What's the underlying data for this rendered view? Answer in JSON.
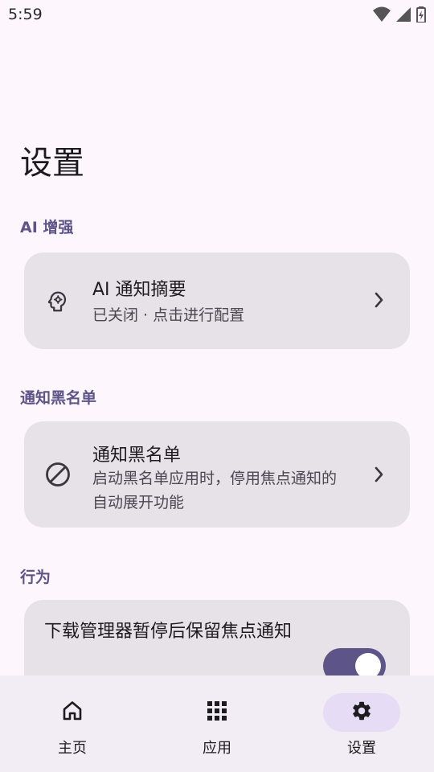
{
  "status_bar": {
    "time": "5:59"
  },
  "page": {
    "title": "设置"
  },
  "sections": {
    "ai": {
      "header": "AI 增强",
      "card": {
        "title": "AI 通知摘要",
        "subtitle": "已关闭 · 点击进行配置",
        "icon": "psychology-icon"
      }
    },
    "blacklist": {
      "header": "通知黑名单",
      "card": {
        "title": "通知黑名单",
        "subtitle": "启动黑名单应用时，停用焦点通知的自动展开功能",
        "icon": "block-icon"
      }
    },
    "behavior": {
      "header": "行为",
      "toggle": {
        "label": "下载管理器暂停后保留焦点通知",
        "checked": true
      }
    }
  },
  "bottom_nav": {
    "items": [
      {
        "label": "主页",
        "icon": "home-icon",
        "active": false
      },
      {
        "label": "应用",
        "icon": "apps-grid-icon",
        "active": false
      },
      {
        "label": "设置",
        "icon": "gear-icon",
        "active": true
      }
    ]
  },
  "colors": {
    "accent": "#5d5488",
    "card_bg": "#e7e1e8",
    "page_bg": "#fdf7fd",
    "nav_bg": "#f2ecf4",
    "active_pill": "#e6dcf6"
  }
}
